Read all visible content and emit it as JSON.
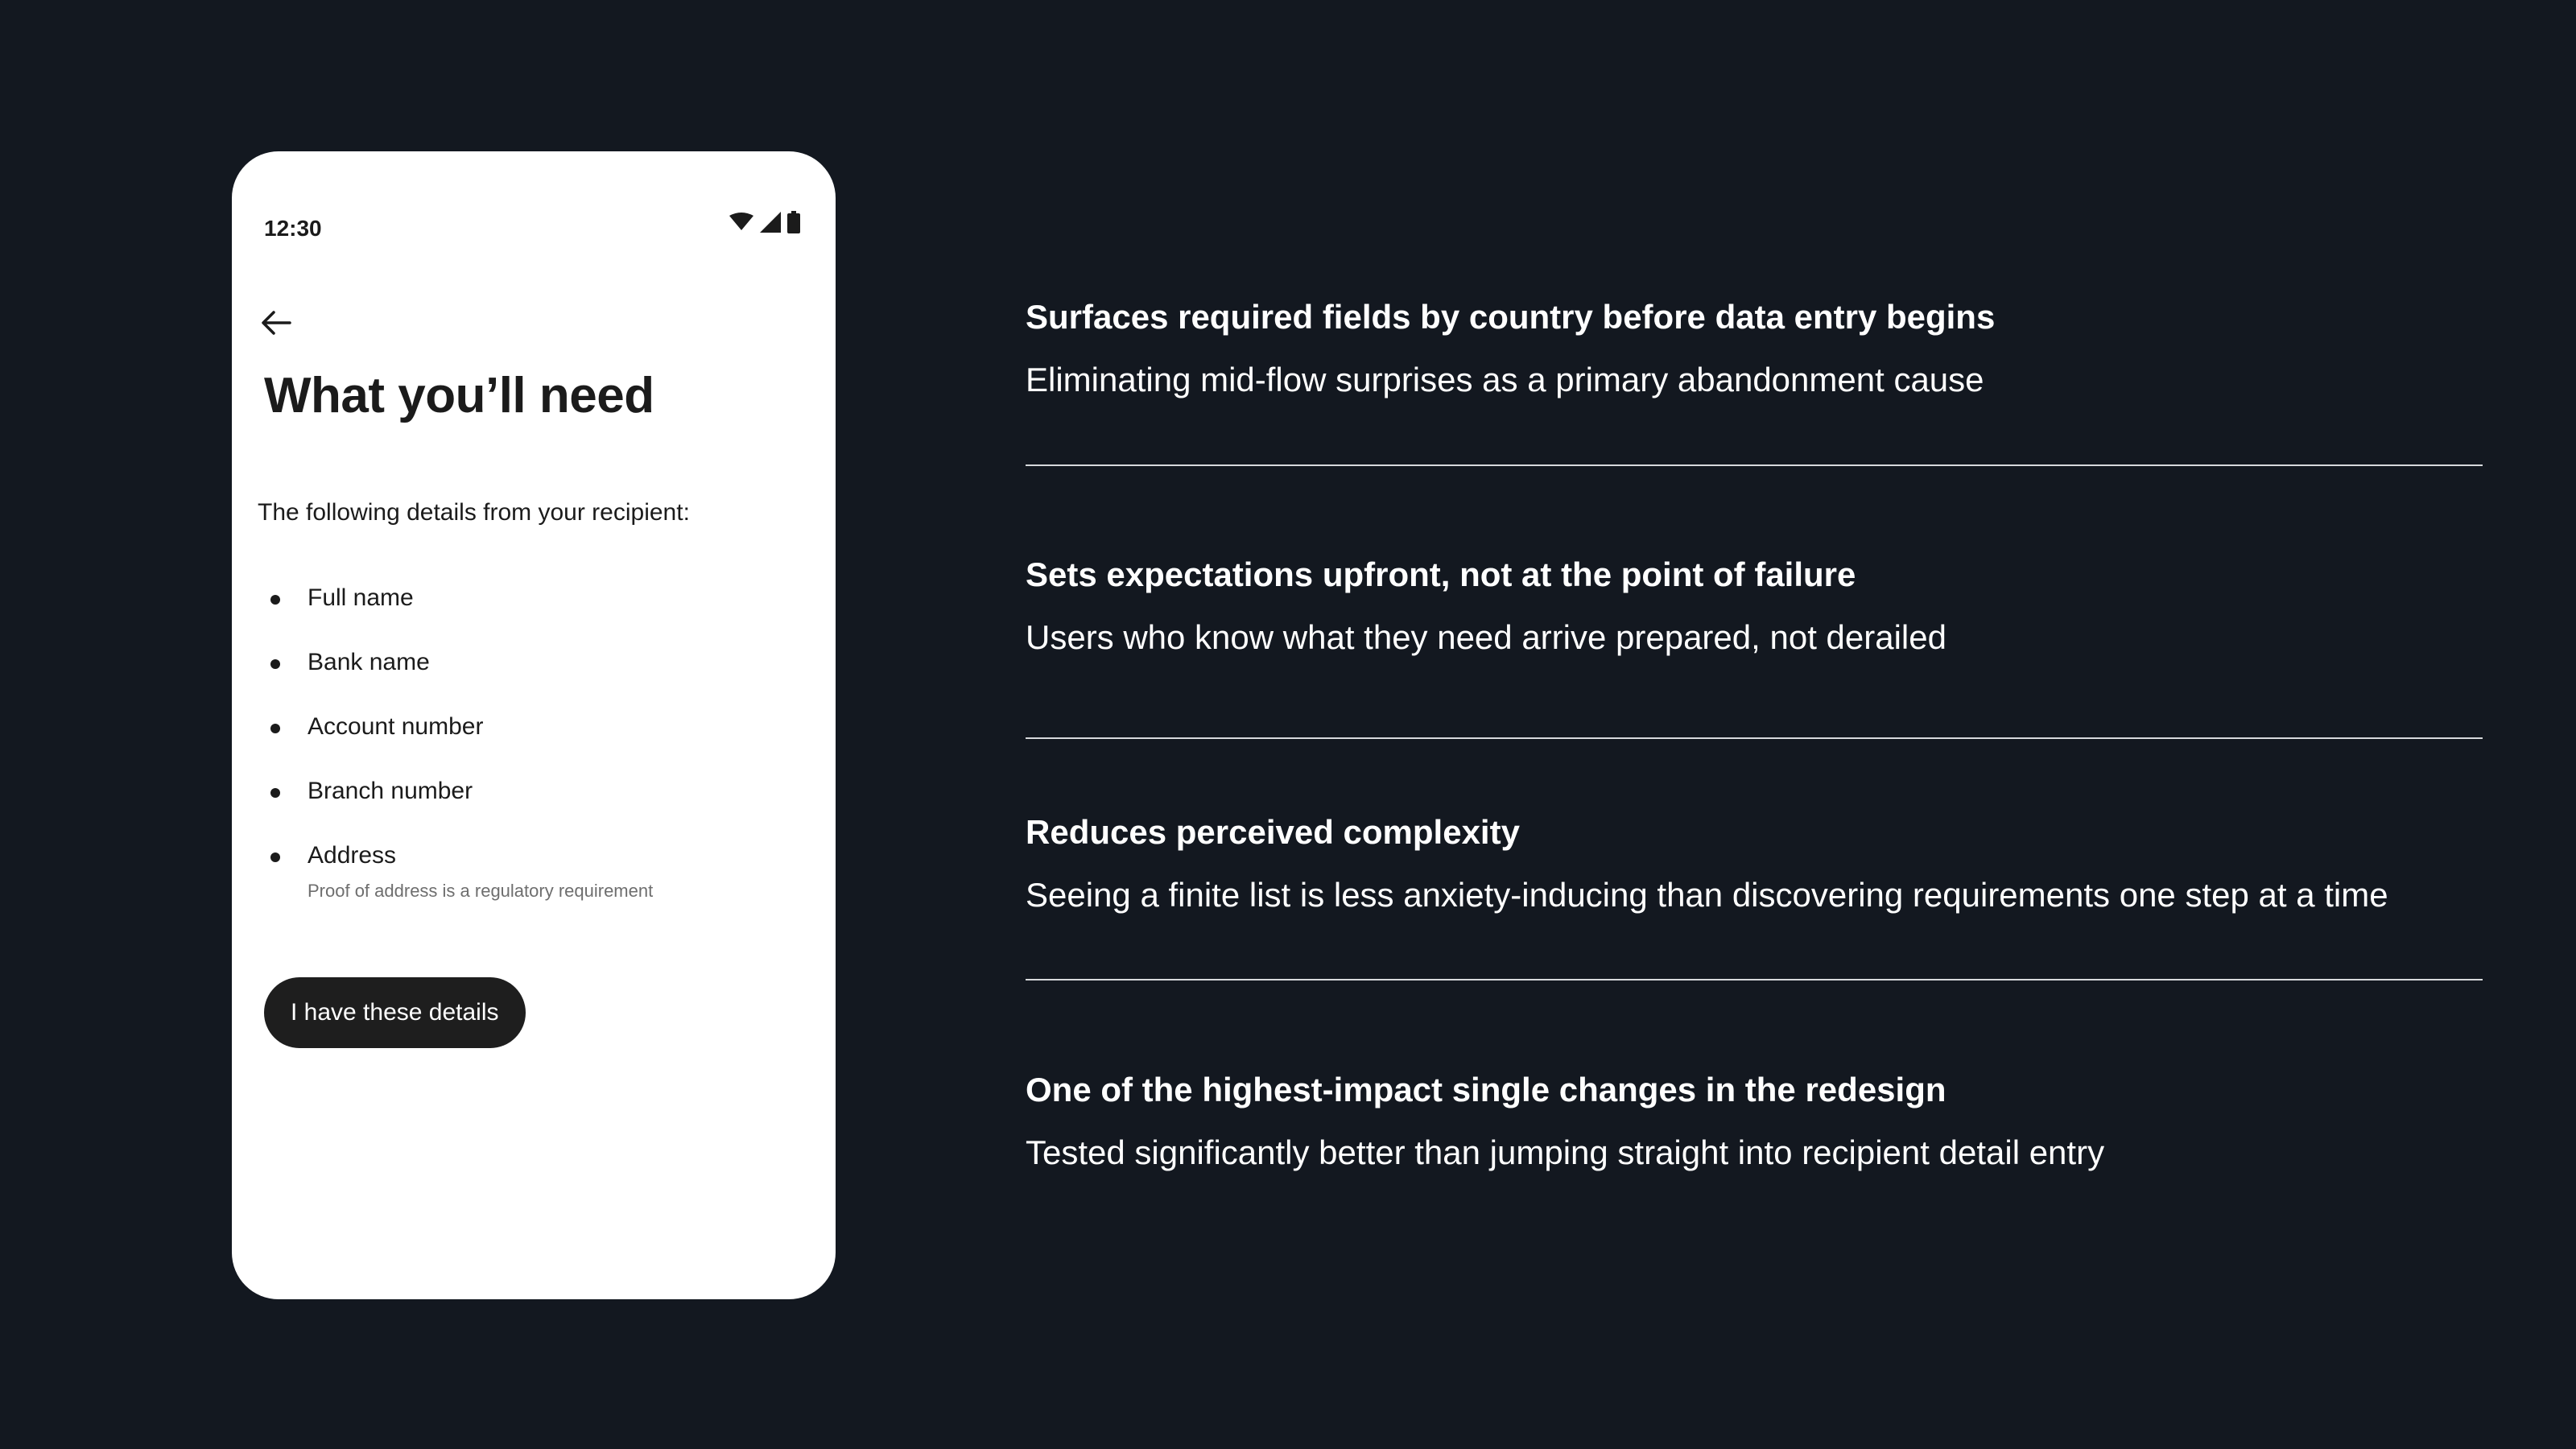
{
  "phone": {
    "status_bar": {
      "time": "12:30",
      "icons": [
        "wifi-icon",
        "cellular-signal-icon",
        "battery-icon"
      ]
    },
    "back_icon": "arrow-left-icon",
    "title": "What you’ll need",
    "intro": "The following details from your recipient:",
    "requirements": [
      {
        "label": "Full name"
      },
      {
        "label": "Bank name"
      },
      {
        "label": "Account number"
      },
      {
        "label": "Branch number"
      },
      {
        "label": "Address",
        "note": "Proof of address is a regulatory requirement"
      }
    ],
    "cta_label": "I have these details"
  },
  "points": [
    {
      "title": "Surfaces required fields by country before data entry begins",
      "subtitle": "Eliminating mid-flow surprises as a primary abandonment cause"
    },
    {
      "title": "Sets expectations upfront, not at the point of failure",
      "subtitle": "Users who know what they need arrive prepared, not derailed"
    },
    {
      "title": "Reduces perceived complexity",
      "subtitle": "Seeing a finite list is less anxiety-inducing than discovering requirements one step at a time"
    },
    {
      "title": "One of the highest-impact single changes in the redesign",
      "subtitle": "Tested significantly better than jumping straight into recipient detail entry"
    }
  ],
  "colors": {
    "background": "#131820",
    "phone_surface": "#ffffff",
    "cta_background": "#1e1e1e",
    "text_light": "#ffffff",
    "text_dark": "#1b1b1b",
    "note_text": "#6e6e6e",
    "divider": "#d7d9dc"
  }
}
